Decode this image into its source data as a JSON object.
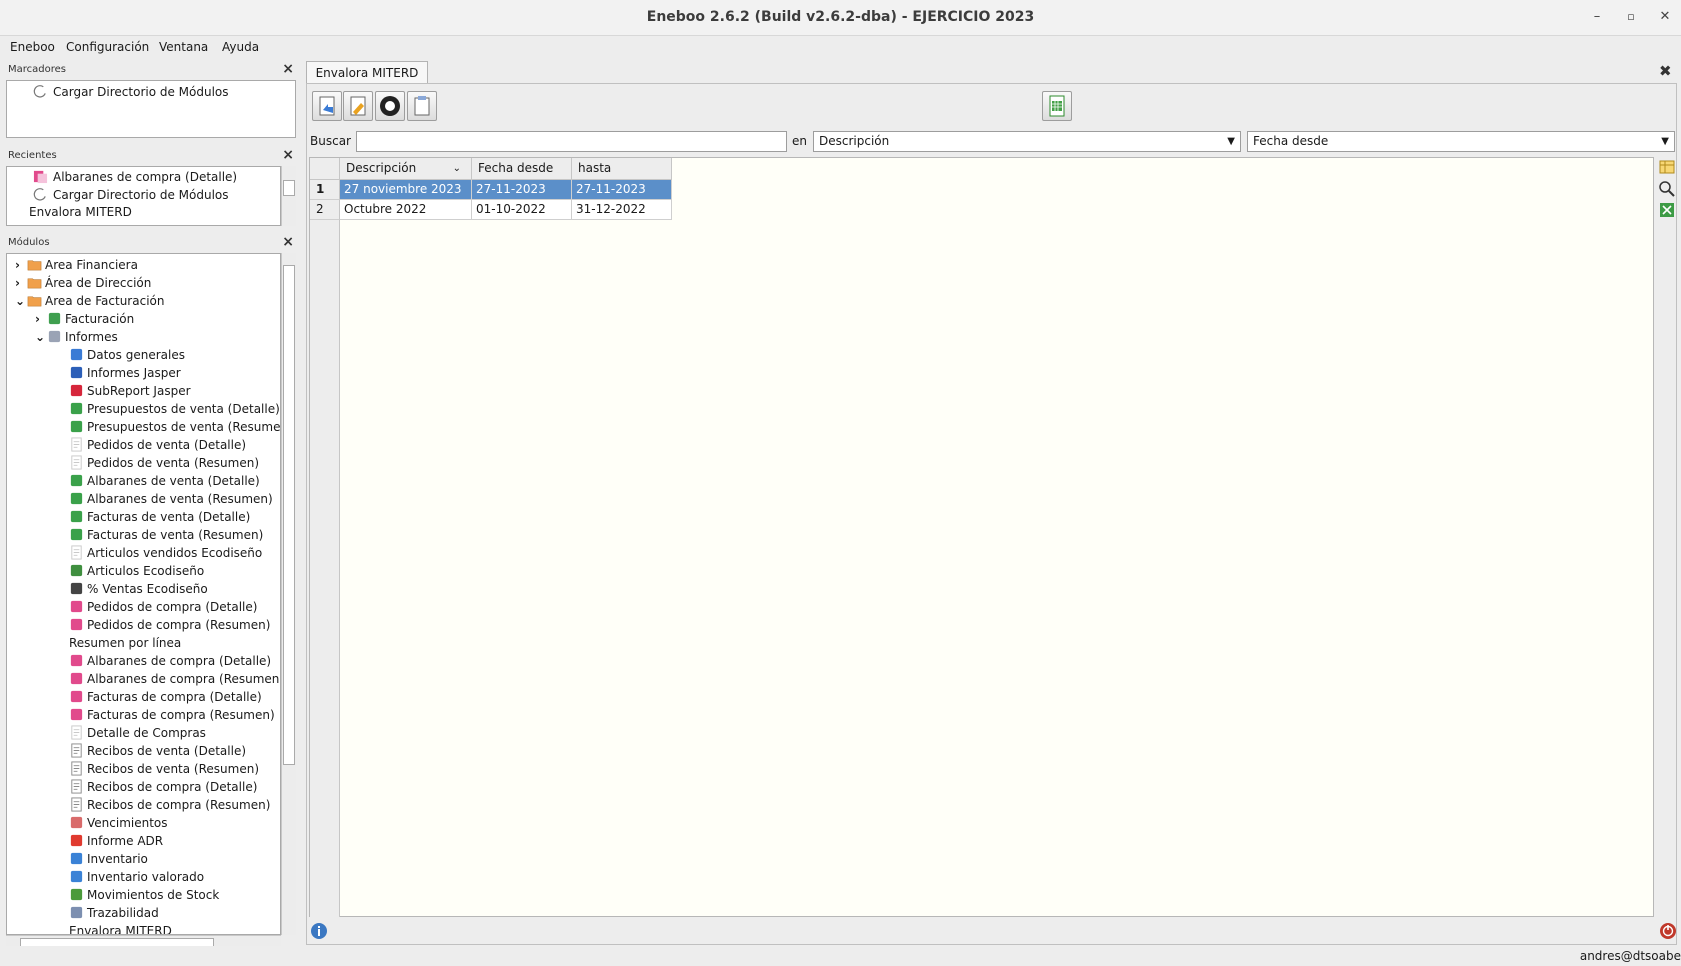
{
  "window": {
    "title": "Eneboo 2.6.2 (Build v2.6.2-dba) - EJERCICIO 2023",
    "minimize_glyph": "–",
    "restore_glyph": "▫",
    "close_glyph": "✕"
  },
  "menu": [
    "Eneboo",
    "Configuración",
    "Ventana",
    "Ayuda"
  ],
  "bookmarks": {
    "title": "Marcadores",
    "items": [
      {
        "label": "Cargar Directorio de Módulos",
        "icon": "reload-icon"
      }
    ]
  },
  "recents": {
    "title": "Recientes",
    "items": [
      {
        "label": "Albaranes de compra (Detalle)",
        "icon": "purchase-report-icon"
      },
      {
        "label": "Cargar Directorio de Módulos",
        "icon": "reload-icon"
      },
      {
        "label": "Envalora MITERD",
        "icon": ""
      }
    ]
  },
  "modules": {
    "title": "Módulos",
    "tree": [
      {
        "label": "Area Financiera",
        "level": 0,
        "expand": "›",
        "icon": "folder-icon"
      },
      {
        "label": "Área de Dirección",
        "level": 0,
        "expand": "›",
        "icon": "folder-icon"
      },
      {
        "label": "Area de Facturación",
        "level": 0,
        "expand": "⌄",
        "icon": "folder-icon"
      },
      {
        "label": "Facturación",
        "level": 1,
        "expand": "›",
        "icon": "billing-icon"
      },
      {
        "label": "Informes",
        "level": 1,
        "expand": "⌄",
        "icon": "reports-icon"
      },
      {
        "label": "Datos generales",
        "level": 2,
        "icon": "general-data-icon"
      },
      {
        "label": "Informes Jasper",
        "level": 2,
        "icon": "jasper-icon"
      },
      {
        "label": "SubReport Jasper",
        "level": 2,
        "icon": "subreport-icon"
      },
      {
        "label": "Presupuestos de venta (Detalle)",
        "level": 2,
        "icon": "sales-report-icon"
      },
      {
        "label": "Presupuestos de venta (Resumen)",
        "level": 2,
        "icon": "sales-report-icon"
      },
      {
        "label": "Pedidos de venta (Detalle)",
        "level": 2,
        "icon": "document-icon"
      },
      {
        "label": "Pedidos de venta (Resumen)",
        "level": 2,
        "icon": "document-icon"
      },
      {
        "label": "Albaranes de venta (Detalle)",
        "level": 2,
        "icon": "sales-report-icon"
      },
      {
        "label": "Albaranes de venta (Resumen)",
        "level": 2,
        "icon": "sales-report-icon"
      },
      {
        "label": "Facturas de venta (Detalle)",
        "level": 2,
        "icon": "sales-report-icon"
      },
      {
        "label": "Facturas de venta (Resumen)",
        "level": 2,
        "icon": "sales-report-icon"
      },
      {
        "label": "Articulos vendidos Ecodiseño",
        "level": 2,
        "icon": "document-icon"
      },
      {
        "label": "Articulos Ecodiseño",
        "level": 2,
        "icon": "leaf-icon"
      },
      {
        "label": "% Ventas Ecodiseño",
        "level": 2,
        "icon": "percent-icon"
      },
      {
        "label": "Pedidos de compra (Detalle)",
        "level": 2,
        "icon": "purchase-report-icon"
      },
      {
        "label": "Pedidos de compra (Resumen)",
        "level": 2,
        "icon": "purchase-report-icon"
      },
      {
        "label": "Resumen por línea",
        "level": 2,
        "icon": "",
        "noicon": true
      },
      {
        "label": "Albaranes de compra (Detalle)",
        "level": 2,
        "icon": "purchase-report-icon"
      },
      {
        "label": "Albaranes de compra (Resumen)",
        "level": 2,
        "icon": "purchase-report-icon"
      },
      {
        "label": "Facturas de compra (Detalle)",
        "level": 2,
        "icon": "purchase-report-icon"
      },
      {
        "label": "Facturas de compra (Resumen)",
        "level": 2,
        "icon": "purchase-report-icon"
      },
      {
        "label": "Detalle de Compras",
        "level": 2,
        "icon": "document-icon"
      },
      {
        "label": "Recibos de venta (Detalle)",
        "level": 2,
        "icon": "receipt-icon"
      },
      {
        "label": "Recibos de venta (Resumen)",
        "level": 2,
        "icon": "receipt-icon"
      },
      {
        "label": "Recibos de compra (Detalle)",
        "level": 2,
        "icon": "receipt-icon"
      },
      {
        "label": "Recibos de compra (Resumen)",
        "level": 2,
        "icon": "receipt-icon"
      },
      {
        "label": "Vencimientos",
        "level": 2,
        "icon": "due-dates-icon"
      },
      {
        "label": "Informe ADR",
        "level": 2,
        "icon": "adr-icon"
      },
      {
        "label": "Inventario",
        "level": 2,
        "icon": "inventory-icon"
      },
      {
        "label": "Inventario valorado",
        "level": 2,
        "icon": "inventory-icon"
      },
      {
        "label": "Movimientos de Stock",
        "level": 2,
        "icon": "stock-moves-icon"
      },
      {
        "label": "Trazabilidad",
        "level": 2,
        "icon": "traceability-icon"
      },
      {
        "label": "Envalora MITERD",
        "level": 2,
        "icon": "",
        "noicon": true
      }
    ]
  },
  "tab": {
    "label": "Envalora MITERD"
  },
  "search": {
    "label": "Buscar",
    "value": "",
    "in_label": "en",
    "field": "Descripción",
    "field2": "Fecha desde"
  },
  "grid": {
    "columns": [
      "Descripción",
      "Fecha desde",
      "hasta"
    ],
    "rows": [
      {
        "num": "1",
        "cells": [
          "27 noviembre 2023",
          "27-11-2023",
          "27-11-2023"
        ],
        "selected": true
      },
      {
        "num": "2",
        "cells": [
          "Octubre 2022",
          "01-10-2022",
          "31-12-2022"
        ],
        "selected": false
      }
    ]
  },
  "status": {
    "user": "andres@dtsoabe"
  },
  "colors": {
    "selection": "#5b8fc9",
    "folder": "#f0a04b"
  }
}
